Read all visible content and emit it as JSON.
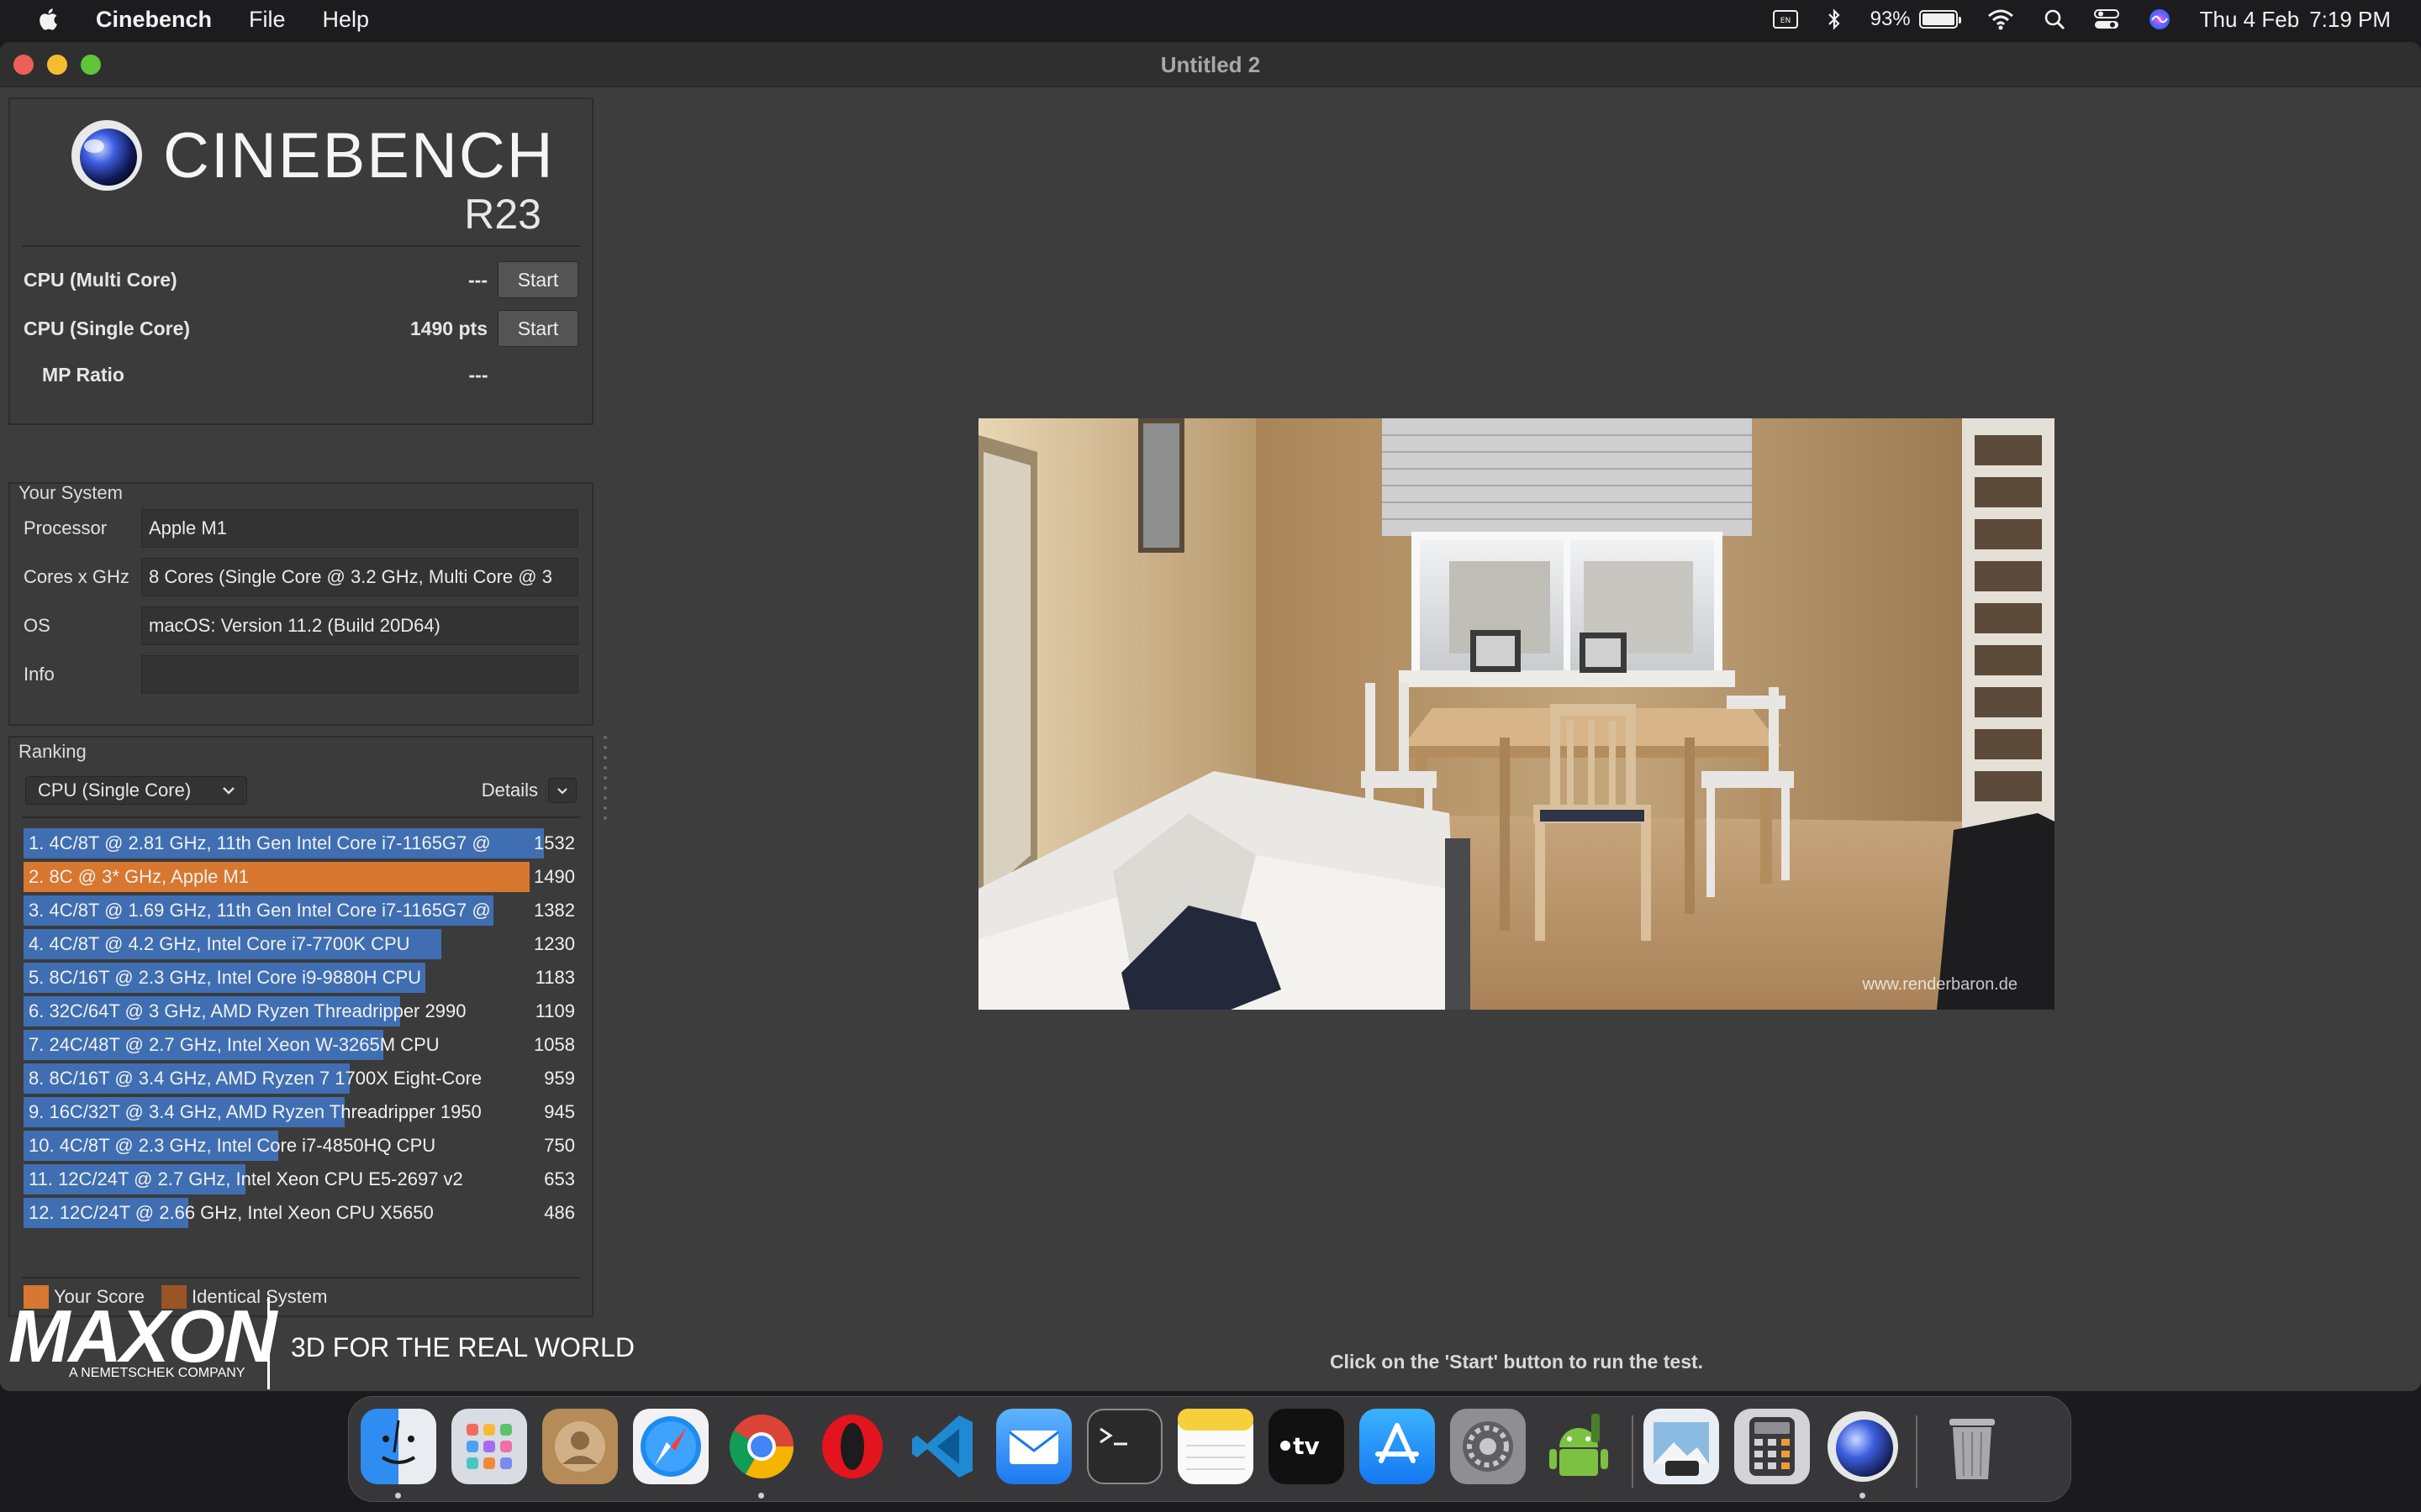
{
  "menubar": {
    "app_name": "Cinebench",
    "menus": [
      "File",
      "Help"
    ],
    "battery": "93%",
    "date": "Thu 4 Feb",
    "time": "7:19 PM"
  },
  "window": {
    "title": "Untitled 2"
  },
  "logo": {
    "name": "CINEBENCH",
    "version": "R23"
  },
  "benchmarks": {
    "multi": {
      "label": "CPU (Multi Core)",
      "score": "---",
      "button": "Start"
    },
    "single": {
      "label": "CPU (Single Core)",
      "score": "1490 pts",
      "button": "Start"
    },
    "mp": {
      "label": "MP Ratio",
      "score": "---"
    }
  },
  "system": {
    "title": "Your System",
    "rows": [
      {
        "key": "Processor",
        "value": "Apple M1"
      },
      {
        "key": "Cores x GHz",
        "value": "8 Cores (Single Core @ 3.2 GHz, Multi Core @ 3"
      },
      {
        "key": "OS",
        "value": "macOS: Version 11.2 (Build 20D64)"
      },
      {
        "key": "Info",
        "value": ""
      }
    ]
  },
  "ranking": {
    "title": "Ranking",
    "dropdown": "CPU (Single Core)",
    "details": "Details",
    "max_score": 1532,
    "items": [
      {
        "label": "1. 4C/8T @ 2.81 GHz, 11th Gen Intel Core i7-1165G7 @",
        "score": "1532",
        "value": 1532,
        "kind": "other"
      },
      {
        "label": "2. 8C @ 3* GHz, Apple M1",
        "score": "1490",
        "value": 1490,
        "kind": "you"
      },
      {
        "label": "3. 4C/8T @ 1.69 GHz, 11th Gen Intel Core i7-1165G7 @",
        "score": "1382",
        "value": 1382,
        "kind": "other"
      },
      {
        "label": "4. 4C/8T @ 4.2 GHz, Intel Core i7-7700K CPU",
        "score": "1230",
        "value": 1230,
        "kind": "other"
      },
      {
        "label": "5. 8C/16T @ 2.3 GHz, Intel Core i9-9880H CPU",
        "score": "1183",
        "value": 1183,
        "kind": "other"
      },
      {
        "label": "6. 32C/64T @ 3 GHz, AMD Ryzen Threadripper 2990",
        "score": "1109",
        "value": 1109,
        "kind": "other"
      },
      {
        "label": "7. 24C/48T @ 2.7 GHz, Intel Xeon W-3265M CPU",
        "score": "1058",
        "value": 1058,
        "kind": "other"
      },
      {
        "label": "8. 8C/16T @ 3.4 GHz, AMD Ryzen 7 1700X Eight-Core",
        "score": "959",
        "value": 959,
        "kind": "other"
      },
      {
        "label": "9. 16C/32T @ 3.4 GHz, AMD Ryzen Threadripper 1950",
        "score": "945",
        "value": 945,
        "kind": "other"
      },
      {
        "label": "10. 4C/8T @ 2.3 GHz, Intel Core i7-4850HQ CPU",
        "score": "750",
        "value": 750,
        "kind": "other"
      },
      {
        "label": "11. 12C/24T @ 2.7 GHz, Intel Xeon CPU E5-2697 v2",
        "score": "653",
        "value": 653,
        "kind": "other"
      },
      {
        "label": "12. 12C/24T @ 2.66 GHz, Intel Xeon CPU X5650",
        "score": "486",
        "value": 486,
        "kind": "other"
      }
    ],
    "legend": [
      {
        "label": "Your Score",
        "color": "#d8772f"
      },
      {
        "label": "Identical System",
        "color": "#9b5426"
      }
    ],
    "bar_color": "#3f6fb2",
    "you_color": "#d8772f"
  },
  "brand": {
    "name": "MAXON",
    "sub": "A NEMETSCHEK COMPANY",
    "tagline": "3D FOR THE REAL WORLD"
  },
  "render": {
    "watermark": "www.renderbaron.de"
  },
  "status": "Click on the 'Start' button to run the test.",
  "dock": {
    "apps": [
      "finder",
      "launchpad",
      "contacts",
      "safari",
      "chrome",
      "opera",
      "vscode",
      "mail",
      "terminal",
      "notes",
      "tv",
      "app-store",
      "system-preferences",
      "android-studio",
      "preview",
      "calculator",
      "cinebench",
      "trash"
    ]
  }
}
